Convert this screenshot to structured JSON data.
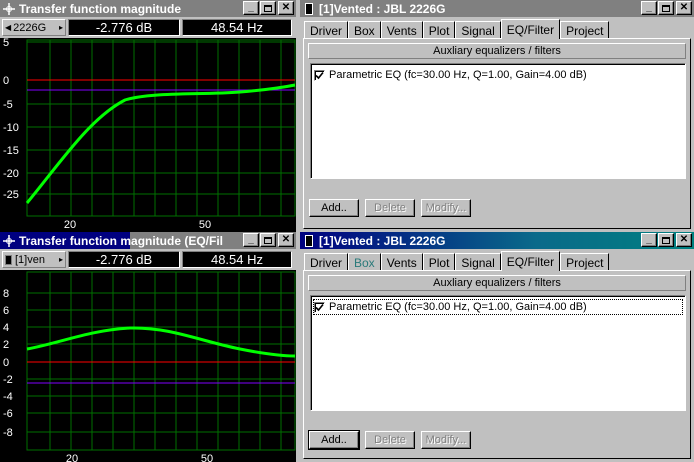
{
  "plots": [
    {
      "title": "Transfer function magnitude",
      "selector": "2226G",
      "readout_db": "-2.776 dB",
      "readout_hz": "48.54 Hz",
      "y_ticks": [
        "5",
        "0",
        "-5",
        "-10",
        "-15",
        "-20",
        "-25"
      ],
      "x_ticks": [
        "20",
        "50"
      ],
      "curve_color": "#00ff00",
      "ref_line_color": "#ff0000",
      "aux_line_color": "#8000ff"
    },
    {
      "title": "Transfer function magnitude (EQ/Filter)",
      "title_visible": "Transfer function magnitude (EQ/Fil",
      "selector": "[1]ven",
      "readout_db": "-2.776 dB",
      "readout_hz": "48.54 Hz",
      "y_ticks": [
        "8",
        "6",
        "4",
        "2",
        "0",
        "-2",
        "-4",
        "-6",
        "-8"
      ],
      "x_ticks": [
        "20",
        "50"
      ],
      "curve_color": "#00ff00",
      "ref_line_color": "#ff0000",
      "aux_line_color": "#8000ff"
    }
  ],
  "panels": [
    {
      "title": "[1]Vented : JBL 2226G",
      "tabs": [
        "Driver",
        "Box",
        "Vents",
        "Plot",
        "Signal",
        "EQ/Filter",
        "Project"
      ],
      "active_tab": "EQ/Filter",
      "section_title": "Auxliary equalizers / filters",
      "items": [
        {
          "label": "Parametric EQ (fc=30.00 Hz, Q=1.00, Gain=4.00 dB)",
          "checked": true
        }
      ],
      "buttons": {
        "add": "Add..",
        "delete": "Delete",
        "modify": "Modify..."
      }
    },
    {
      "title": "[1]Vented : JBL 2226G",
      "tabs": [
        "Driver",
        "Box",
        "Vents",
        "Plot",
        "Signal",
        "EQ/Filter",
        "Project"
      ],
      "active_tab": "EQ/Filter",
      "section_title": "Auxliary equalizers / filters",
      "items": [
        {
          "label": "Parametric EQ (fc=30.00 Hz, Q=1.00, Gain=4.00 dB)",
          "checked": true
        }
      ],
      "buttons": {
        "add": "Add..",
        "delete": "Delete",
        "modify": "Modify..."
      }
    }
  ],
  "colors": {
    "title_active": "#000080",
    "title_inactive": "#808080",
    "window": "#c0c0c0",
    "grid": "#007000"
  },
  "icons": [
    "crosshair-icon",
    "speaker-icon",
    "minimize-icon",
    "maximize-icon",
    "close-icon",
    "check-icon"
  ]
}
